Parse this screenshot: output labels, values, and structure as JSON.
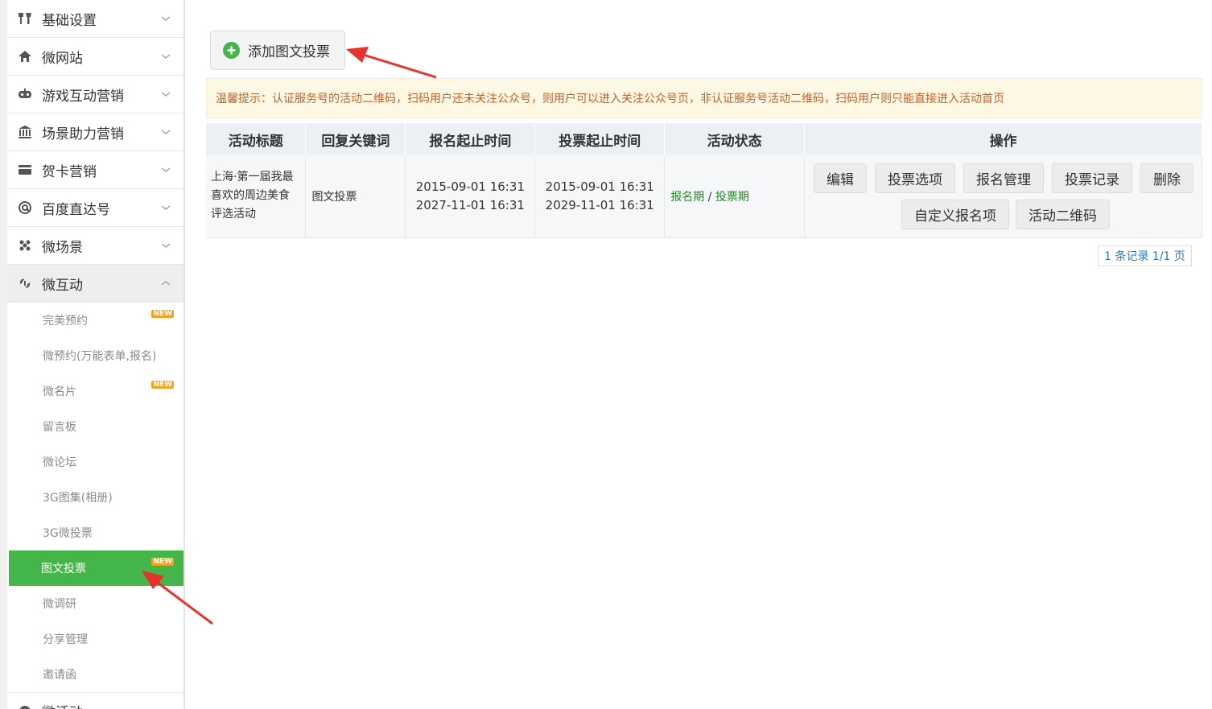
{
  "sidebar": {
    "menus": [
      {
        "label": "基础设置",
        "icon": "tools-icon"
      },
      {
        "label": "微网站",
        "icon": "home-icon"
      },
      {
        "label": "游戏互动营销",
        "icon": "gamepad-icon"
      },
      {
        "label": "场景助力营销",
        "icon": "bank-icon"
      },
      {
        "label": "贺卡营销",
        "icon": "card-icon"
      },
      {
        "label": "百度直达号",
        "icon": "at-icon"
      },
      {
        "label": "微场景",
        "icon": "dots-icon"
      }
    ],
    "open_menu": {
      "label": "微互动",
      "icon": "interact-icon"
    },
    "sub_items": [
      {
        "label": "完美预约",
        "badge": "NEW"
      },
      {
        "label": "微预约(万能表单,报名)",
        "badge": ""
      },
      {
        "label": "微名片",
        "badge": "NEW"
      },
      {
        "label": "留言板",
        "badge": ""
      },
      {
        "label": "微论坛",
        "badge": ""
      },
      {
        "label": "3G图集(相册)",
        "badge": ""
      },
      {
        "label": "3G微投票",
        "badge": ""
      },
      {
        "label": "图文投票",
        "badge": "NEW"
      },
      {
        "label": "微调研",
        "badge": ""
      },
      {
        "label": "分享管理",
        "badge": ""
      },
      {
        "label": "邀请函",
        "badge": ""
      }
    ],
    "active_sub": "图文投票",
    "bottom_menu": {
      "label": "微活动"
    }
  },
  "toolbar": {
    "add_label": "添加图文投票"
  },
  "tip": "温馨提示：认证服务号的活动二维码，扫码用户还未关注公众号，则用户可以进入关注公众号页，非认证服务号活动二维码，扫码用户则只能直接进入活动首页",
  "table": {
    "headers": [
      "活动标题",
      "回复关键词",
      "报名起止时间",
      "投票起止时间",
      "活动状态",
      "操作"
    ],
    "rows": [
      {
        "title": "上海·第一届我最喜欢的周边美食评选活动",
        "keyword": "图文投票",
        "signup_start": "2015-09-01 16:31",
        "signup_end": "2027-11-01 16:31",
        "vote_start": "2015-09-01 16:31",
        "vote_end": "2029-11-01 16:31",
        "status_a": "报名期",
        "status_sep": "/",
        "status_b": "投票期"
      }
    ],
    "actions_row1": [
      "编辑",
      "投票选项",
      "报名管理",
      "投票记录",
      "删除"
    ],
    "actions_row2": [
      "自定义报名项",
      "活动二维码"
    ]
  },
  "pager": "1 条记录 1/1 页",
  "colors": {
    "accent_green": "#44b549",
    "badge_orange": "#f7a21b",
    "tip_text": "#c0622a",
    "arrow_red": "#e8322e"
  }
}
